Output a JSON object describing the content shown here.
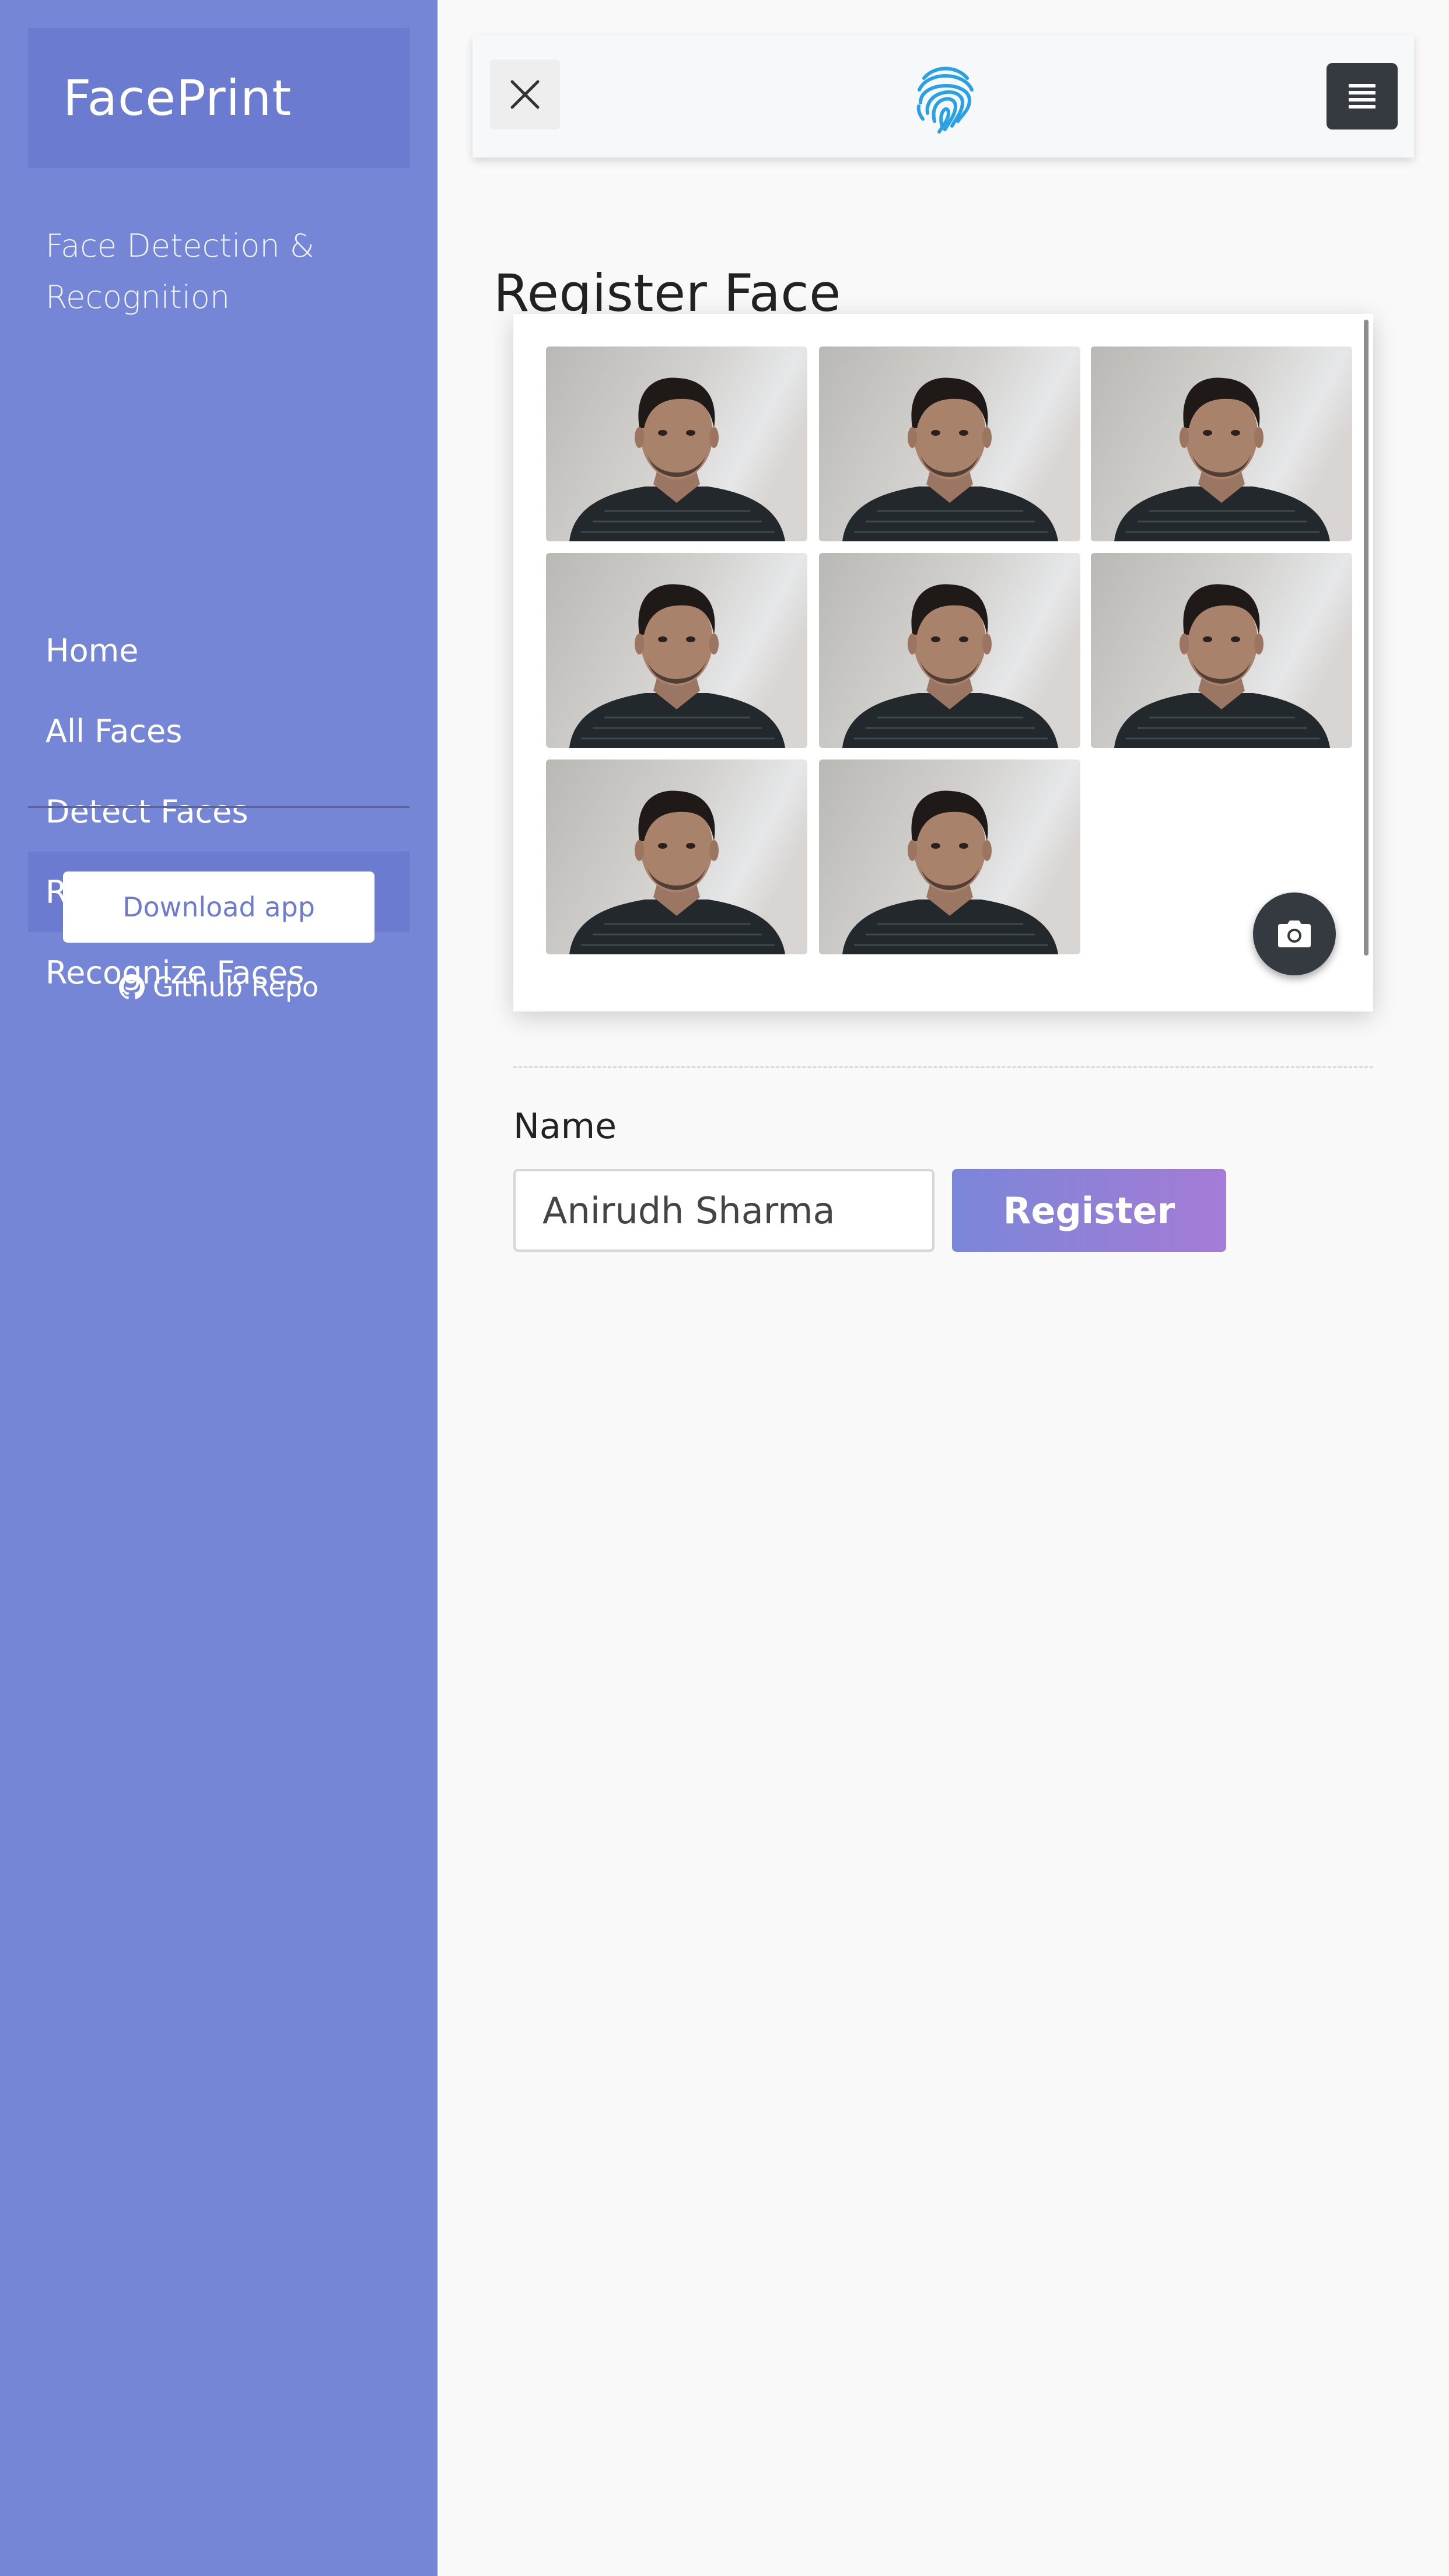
{
  "sidebar": {
    "brand": "FacePrint",
    "tagline": "Face Detection & Recognition",
    "nav": [
      {
        "label": "Home",
        "active": false
      },
      {
        "label": "All Faces",
        "active": false
      },
      {
        "label": "Detect Faces",
        "active": false
      },
      {
        "label": "Register Face",
        "active": true
      },
      {
        "label": "Recognize Faces",
        "active": false
      }
    ],
    "download_label": "Download app",
    "repo_label": "Github Repo"
  },
  "topbar": {
    "close_icon": "close-icon",
    "logo_icon": "fingerprint-icon",
    "menu_icon": "list-menu-icon"
  },
  "main": {
    "title": "Register Face",
    "capture": {
      "photo_count": 8,
      "camera_icon": "camera-icon"
    },
    "form": {
      "name_label": "Name",
      "name_value": "Anirudh Sharma",
      "register_label": "Register"
    }
  },
  "colors": {
    "sidebar": "#7486d5",
    "sidebar_active": "#6b7bcf",
    "accent_start": "#7a86d8",
    "accent_end": "#a57bd6",
    "dark_button": "#343a40",
    "logo_blue": "#2aa1e4"
  }
}
